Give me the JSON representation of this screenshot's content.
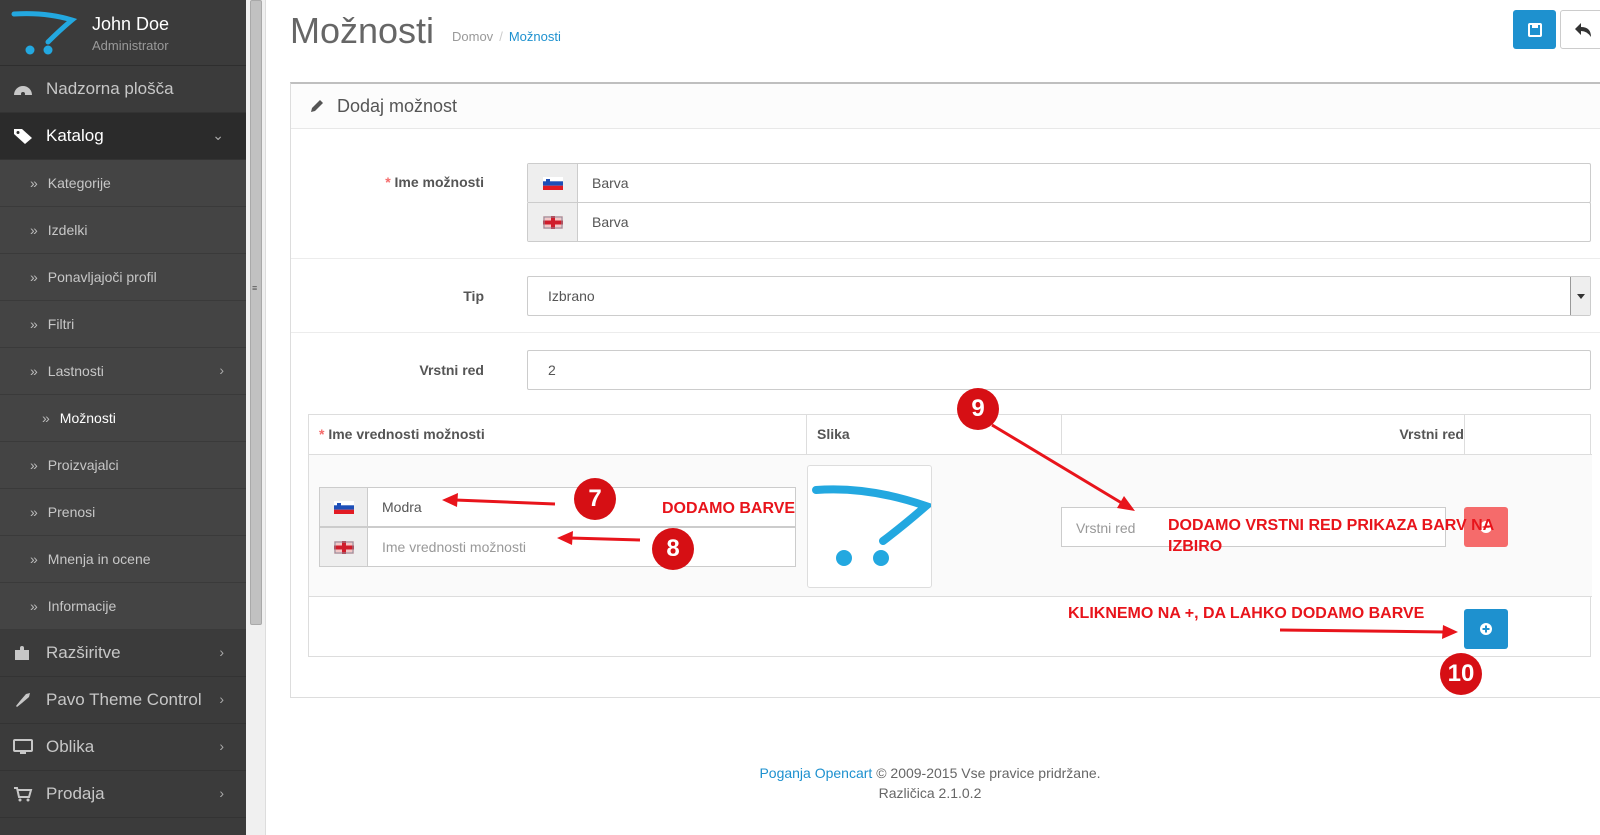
{
  "user": {
    "name": "John Doe",
    "role": "Administrator"
  },
  "sidebar": {
    "items": [
      {
        "label": "Nadzorna plošča",
        "icon": "dashboard-icon"
      },
      {
        "label": "Katalog",
        "icon": "tags-icon",
        "active": true
      },
      {
        "label": "Razširitve",
        "icon": "puzzle-icon"
      },
      {
        "label": "Pavo Theme Control",
        "icon": "rocket-icon"
      },
      {
        "label": "Oblika",
        "icon": "desktop-icon"
      },
      {
        "label": "Prodaja",
        "icon": "cart-icon"
      }
    ],
    "catalog_children": [
      "Kategorije",
      "Izdelki",
      "Ponavljajoči profil",
      "Filtri",
      "Lastnosti",
      "Možnosti",
      "Proizvajalci",
      "Prenosi",
      "Mnenja in ocene",
      "Informacije"
    ]
  },
  "header": {
    "title": "Možnosti",
    "breadcrumb": [
      "Domov",
      "Možnosti"
    ],
    "save_icon": "save-icon",
    "back_icon": "reply-icon"
  },
  "panel": {
    "heading": "Dodaj možnost",
    "option_name_label": "Ime možnosti",
    "option_name_sl": "Barva",
    "option_name_en": "Barva",
    "type_label": "Tip",
    "type_value": "Izbrano",
    "sort_label": "Vrstni red",
    "sort_value": "2"
  },
  "values_table": {
    "headers": [
      "Ime vrednosti možnosti",
      "Slika",
      "Vrstni red"
    ],
    "row": {
      "name_sl": "Modra",
      "name_en_placeholder": "Ime vrednosti možnosti",
      "sort_placeholder": "Vrstni red"
    }
  },
  "annotations": {
    "add_colors": "DODAMO BARVE",
    "add_order_1": "DODAMO VRSTNI RED PRIKAZA BARV NA",
    "add_order_2": "IZBIRO",
    "click_plus": "KLIKNEMO NA +, DA LAHKO DODAMO BARVE",
    "badges": [
      "7",
      "8",
      "9",
      "10"
    ]
  },
  "footer": {
    "link": "Poganja Opencart",
    "copyright": " © 2009-2015 Vse pravice pridržane.",
    "version": "Različica 2.1.0.2"
  },
  "colors": {
    "sidebar": "#3b3b3b",
    "primary": "#1e91cf",
    "danger": "#f56b6b",
    "annotation": "#e8141b"
  }
}
